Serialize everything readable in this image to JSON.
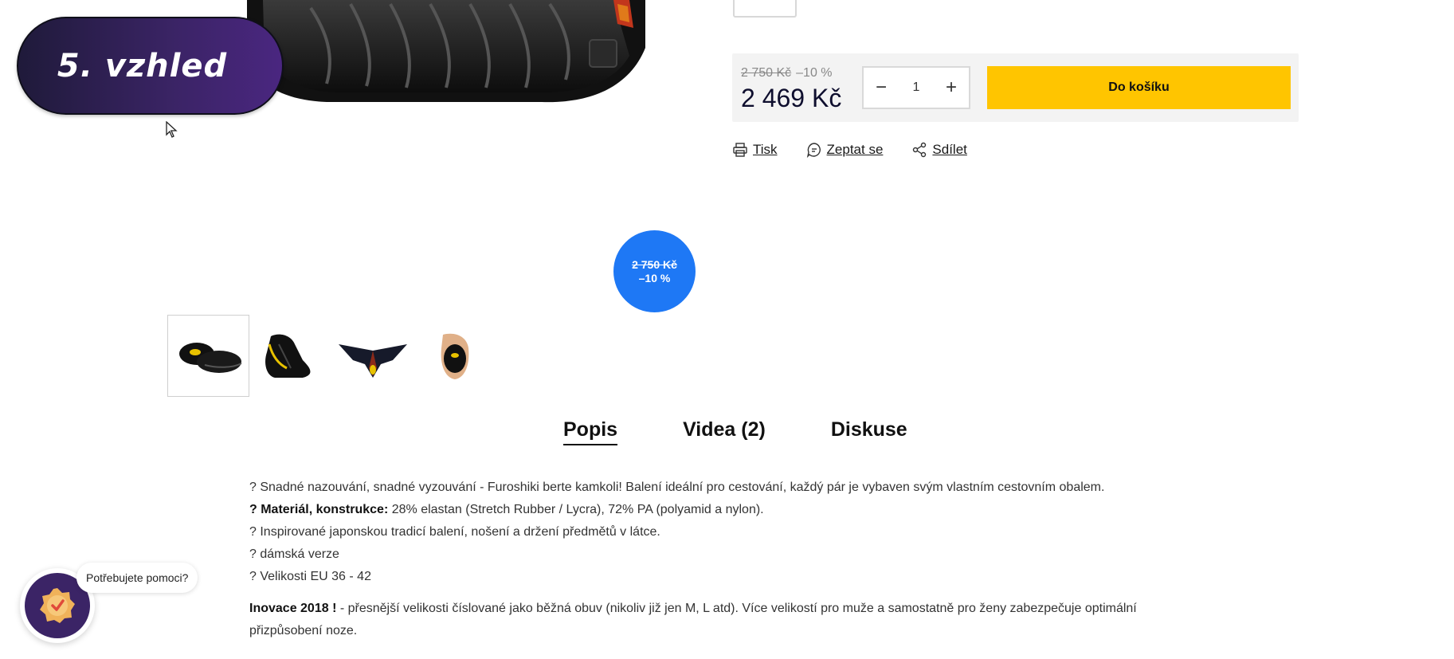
{
  "overlay": {
    "label": "5. vzhled"
  },
  "buy_box": {
    "old_price": "2 750 Kč",
    "discount": "–10 %",
    "price": "2 469 Kč",
    "quantity": "1",
    "decrease_symbol": "−",
    "increase_symbol": "+",
    "add_to_cart": "Do košíku",
    "accent_color": "#ffc500"
  },
  "actions": [
    {
      "label": "Tisk",
      "icon": "printer-icon"
    },
    {
      "label": "Zeptat se",
      "icon": "chat-icon"
    },
    {
      "label": "Sdílet",
      "icon": "share-icon"
    }
  ],
  "discount_badge": {
    "old_price": "2 750 Kč",
    "discount": "–10 %",
    "color": "#1e78f5"
  },
  "thumbnails": [
    {
      "icon": "shoe-pair-thumbnail",
      "active": true
    },
    {
      "icon": "shoe-side-thumbnail",
      "active": false
    },
    {
      "icon": "shoe-unfolded-thumbnail",
      "active": false
    },
    {
      "icon": "shoe-in-hand-thumbnail",
      "active": false
    }
  ],
  "tabs": [
    {
      "label": "Popis",
      "active": true
    },
    {
      "label": "Videa (2)",
      "active": false
    },
    {
      "label": "Diskuse",
      "active": false
    }
  ],
  "description": {
    "line1": "? Snadné nazouvání, snadné vyzouvání - Furoshiki berte kamkoli! Balení ideální pro cestování, každý pár je vybaven svým vlastním cestovním obalem.",
    "line2_bold": "? Materiál, konstrukce:",
    "line2_rest": " 28% elastan (Stretch Rubber / Lycra), 72% PA (polyamid a nylon).",
    "line3": "? Inspirované japonskou tradicí balení, nošení a držení předmětů v látce.",
    "line4": "? dámská verze",
    "line5": "? Velikosti EU 36 - 42",
    "para2_bold": "Inovace 2018 !",
    "para2_rest": " - přesnější velikosti číslované jako běžná obuv (nikoliv již jen M, L atd). Více velikostí pro muže a samostatně pro ženy zabezpečuje optimální",
    "para2_rest2": "přizpůsobení noze."
  },
  "help": {
    "bubble": "Potřebujete pomoci?",
    "icon": "badge-check-icon"
  }
}
